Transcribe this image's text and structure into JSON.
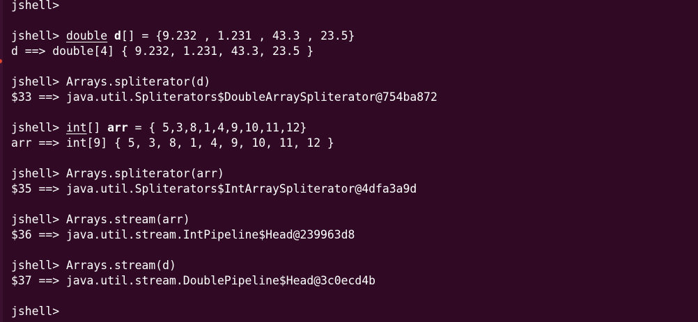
{
  "terminal": {
    "lines": [
      [
        {
          "text": "jshell>"
        }
      ],
      [
        {
          "text": ""
        }
      ],
      [
        {
          "text": "jshell> "
        },
        {
          "text": "double",
          "style": "kw"
        },
        {
          "text": " "
        },
        {
          "text": "d",
          "style": "bold"
        },
        {
          "text": "[] = {9.232 , 1.231 , 43.3 , 23.5}"
        }
      ],
      [
        {
          "text": "d ==> double[4] { 9.232, 1.231, 43.3, 23.5 }"
        }
      ],
      [
        {
          "text": ""
        }
      ],
      [
        {
          "text": "jshell> Arrays.spliterator(d)"
        }
      ],
      [
        {
          "text": "$33 ==> java.util.Spliterators$DoubleArraySpliterator@754ba872"
        }
      ],
      [
        {
          "text": ""
        }
      ],
      [
        {
          "text": "jshell> "
        },
        {
          "text": "int",
          "style": "kw"
        },
        {
          "text": "[] "
        },
        {
          "text": "arr",
          "style": "bold"
        },
        {
          "text": " = { 5,3,8,1,4,9,10,11,12}"
        }
      ],
      [
        {
          "text": "arr ==> int[9] { 5, 3, 8, 1, 4, 9, 10, 11, 12 }"
        }
      ],
      [
        {
          "text": ""
        }
      ],
      [
        {
          "text": "jshell> Arrays.spliterator(arr)"
        }
      ],
      [
        {
          "text": "$35 ==> java.util.Spliterators$IntArraySpliterator@4dfa3a9d"
        }
      ],
      [
        {
          "text": ""
        }
      ],
      [
        {
          "text": "jshell> Arrays.stream(arr)"
        }
      ],
      [
        {
          "text": "$36 ==> java.util.stream.IntPipeline$Head@239963d8"
        }
      ],
      [
        {
          "text": ""
        }
      ],
      [
        {
          "text": "jshell> Arrays.stream(d)"
        }
      ],
      [
        {
          "text": "$37 ==> java.util.stream.DoublePipeline$Head@3c0ecd4b"
        }
      ],
      [
        {
          "text": ""
        }
      ],
      [
        {
          "text": "jshell>"
        }
      ]
    ]
  },
  "colors": {
    "background": "#300a24",
    "foreground": "#ffffff",
    "marker": "#e0452e"
  }
}
